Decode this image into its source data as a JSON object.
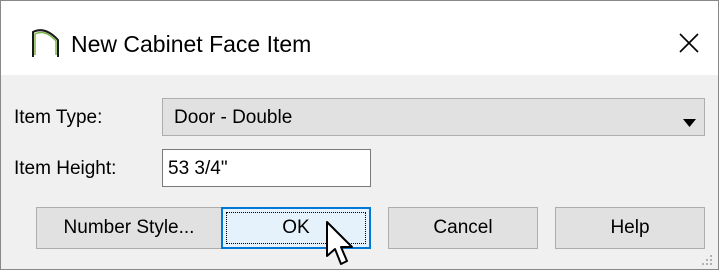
{
  "dialog": {
    "title": "New Cabinet Face Item",
    "app_icon": "arch-icon",
    "close_icon": "close-icon"
  },
  "form": {
    "item_type_label": "Item Type:",
    "item_type_value": "Door - Double",
    "item_type_arrow_icon": "dropdown-arrow-icon",
    "item_height_label": "Item Height:",
    "item_height_value": "53 3/4\""
  },
  "buttons": {
    "number_style": "Number Style...",
    "ok": "OK",
    "cancel": "Cancel",
    "help": "Help"
  },
  "colors": {
    "focus_border": "#0078d7",
    "button_face": "#e1e1e1",
    "dialog_bg": "#f0f0f0"
  },
  "cursor_icon": "mouse-pointer-icon",
  "resize_grip_icon": "resize-grip-icon"
}
